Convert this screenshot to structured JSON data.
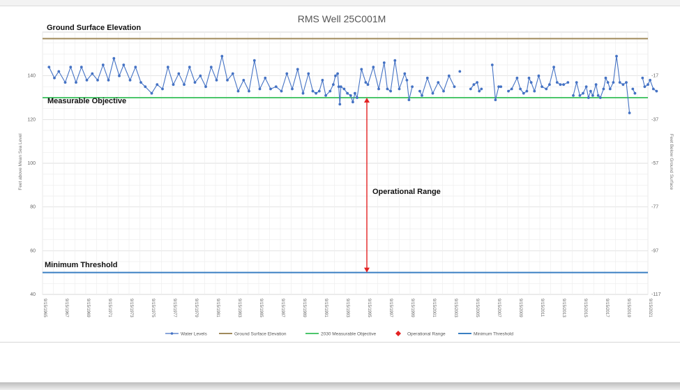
{
  "chart_data": {
    "type": "line",
    "title": "RMS Well 25C001M",
    "ylabel": "Feet above Mean Sea Level",
    "y2label": "Feet Below Ground Surface",
    "ylim": [
      40,
      160
    ],
    "y_ticks": [
      40,
      60,
      80,
      100,
      120,
      140
    ],
    "y2_ticks": [
      -117,
      -97,
      -77,
      -57,
      -37,
      -17
    ],
    "grid": true,
    "x_tick_labels": [
      "9/15/1965",
      "9/15/1967",
      "9/15/1969",
      "9/15/1971",
      "9/15/1973",
      "9/15/1975",
      "9/15/1977",
      "9/15/1979",
      "9/15/1981",
      "9/15/1983",
      "9/15/1985",
      "9/15/1987",
      "9/15/1989",
      "9/15/1991",
      "9/15/1993",
      "9/15/1995",
      "9/15/1997",
      "9/15/1999",
      "9/15/2001",
      "9/15/2003",
      "9/15/2005",
      "9/15/2007",
      "9/15/2009",
      "9/15/2011",
      "9/15/2013",
      "9/15/2015",
      "9/15/2017",
      "9/15/2019",
      "9/15/2021"
    ],
    "legend_position": "bottom",
    "legend": [
      {
        "key": "water",
        "label": "Water Levels",
        "color": "#4472c4",
        "style": "line-marker"
      },
      {
        "key": "gse",
        "label": "Ground Surface Elevation",
        "color": "#a08a5c",
        "style": "line"
      },
      {
        "key": "mo",
        "label": "2030 Measurable Objective",
        "color": "#4cc66b",
        "style": "line"
      },
      {
        "key": "op",
        "label": "Operational Range",
        "color": "#e32222",
        "style": "diamond"
      },
      {
        "key": "mt",
        "label": "Minimum Threshold",
        "color": "#3a7fc2",
        "style": "line"
      }
    ],
    "reference_lines": [
      {
        "key": "gse",
        "name": "Ground Surface Elevation",
        "value": 157,
        "color": "#a08a5c"
      },
      {
        "key": "mo",
        "name": "Measurable Objective",
        "value": 130,
        "color": "#4cc66b"
      },
      {
        "key": "mt",
        "name": "Minimum Threshold",
        "value": 50,
        "color": "#3a7fc2"
      }
    ],
    "operational_range": {
      "label": "Operational Range",
      "x": 1995.7,
      "from": 130,
      "to": 50,
      "color": "#e32222"
    },
    "series": [
      {
        "name": "Water Levels",
        "color": "#4472c4",
        "segments": [
          [
            [
              1966.3,
              144
            ],
            [
              1966.8,
              139
            ],
            [
              1967.2,
              142
            ],
            [
              1967.8,
              137
            ],
            [
              1968.3,
              144
            ],
            [
              1968.8,
              137
            ],
            [
              1969.3,
              144
            ],
            [
              1969.8,
              138
            ],
            [
              1970.3,
              141
            ],
            [
              1970.8,
              138
            ],
            [
              1971.3,
              145
            ],
            [
              1971.8,
              138
            ],
            [
              1972.3,
              148
            ],
            [
              1972.8,
              140
            ],
            [
              1973.2,
              145
            ],
            [
              1973.8,
              138
            ],
            [
              1974.3,
              144
            ],
            [
              1974.8,
              137
            ],
            [
              1975.2,
              135
            ],
            [
              1975.8,
              132
            ],
            [
              1976.3,
              136
            ],
            [
              1976.8,
              134
            ],
            [
              1977.3,
              144
            ],
            [
              1977.8,
              136
            ],
            [
              1978.3,
              141
            ],
            [
              1978.8,
              136
            ],
            [
              1979.3,
              144
            ],
            [
              1979.8,
              137
            ],
            [
              1980.3,
              140
            ],
            [
              1980.8,
              135
            ],
            [
              1981.3,
              144
            ],
            [
              1981.8,
              138
            ],
            [
              1982.3,
              149
            ],
            [
              1982.8,
              138
            ],
            [
              1983.3,
              141
            ],
            [
              1983.8,
              133
            ],
            [
              1984.3,
              138
            ],
            [
              1984.8,
              133
            ],
            [
              1985.3,
              147
            ],
            [
              1985.8,
              134
            ],
            [
              1986.3,
              139
            ],
            [
              1986.8,
              134
            ],
            [
              1987.3,
              135
            ],
            [
              1987.8,
              133
            ],
            [
              1988.3,
              141
            ],
            [
              1988.8,
              134
            ],
            [
              1989.3,
              143
            ],
            [
              1989.8,
              132
            ],
            [
              1990.3,
              141
            ],
            [
              1990.7,
              133
            ],
            [
              1991.0,
              132
            ],
            [
              1991.3,
              133
            ],
            [
              1991.6,
              138
            ],
            [
              1991.9,
              131
            ],
            [
              1992.3,
              133
            ],
            [
              1992.6,
              136
            ],
            [
              1992.8,
              140
            ],
            [
              1993.0,
              141
            ],
            [
              1993.1,
              135
            ],
            [
              1993.2,
              127
            ],
            [
              1993.3,
              135
            ],
            [
              1993.6,
              134
            ],
            [
              1993.9,
              132
            ],
            [
              1994.2,
              131
            ],
            [
              1994.4,
              128
            ],
            [
              1994.6,
              132
            ],
            [
              1994.8,
              130
            ],
            [
              1995.2,
              143
            ],
            [
              1995.6,
              137
            ],
            [
              1995.8,
              136
            ],
            [
              1996.3,
              144
            ],
            [
              1996.8,
              134
            ],
            [
              1997.3,
              146
            ],
            [
              1997.6,
              134
            ],
            [
              1997.9,
              133
            ],
            [
              1998.3,
              147
            ],
            [
              1998.7,
              134
            ],
            [
              1999.2,
              141
            ],
            [
              1999.4,
              138
            ],
            [
              1999.6,
              129
            ],
            [
              1999.9,
              135
            ]
          ],
          [
            [
              2000.6,
              133
            ],
            [
              2000.8,
              131
            ],
            [
              2001.3,
              139
            ],
            [
              2001.8,
              132
            ],
            [
              2002.3,
              137
            ],
            [
              2002.8,
              133
            ],
            [
              2003.3,
              140
            ],
            [
              2003.8,
              135
            ]
          ],
          [
            [
              2004.3,
              142
            ]
          ],
          [
            [
              2005.3,
              134
            ],
            [
              2005.6,
              136
            ],
            [
              2005.9,
              137
            ],
            [
              2006.1,
              133
            ],
            [
              2006.3,
              134
            ]
          ],
          [
            [
              2007.3,
              145
            ],
            [
              2007.6,
              129
            ],
            [
              2007.9,
              135
            ],
            [
              2008.1,
              135
            ]
          ],
          [
            [
              2008.8,
              133
            ],
            [
              2009.1,
              134
            ],
            [
              2009.6,
              139
            ],
            [
              2009.9,
              134
            ],
            [
              2010.2,
              132
            ],
            [
              2010.5,
              133
            ],
            [
              2010.7,
              139
            ],
            [
              2010.9,
              137
            ],
            [
              2011.2,
              133
            ],
            [
              2011.6,
              140
            ],
            [
              2011.9,
              135
            ],
            [
              2012.3,
              134
            ],
            [
              2012.6,
              136
            ],
            [
              2013.0,
              144
            ],
            [
              2013.3,
              137
            ],
            [
              2013.6,
              136
            ],
            [
              2013.9,
              136
            ],
            [
              2014.3,
              137
            ]
          ],
          [
            [
              2014.8,
              131
            ],
            [
              2015.1,
              137
            ],
            [
              2015.4,
              131
            ],
            [
              2015.7,
              132
            ],
            [
              2016.0,
              135
            ],
            [
              2016.2,
              130
            ],
            [
              2016.4,
              133
            ],
            [
              2016.6,
              131
            ],
            [
              2016.9,
              136
            ],
            [
              2017.1,
              131
            ],
            [
              2017.3,
              130
            ],
            [
              2017.6,
              134
            ],
            [
              2017.8,
              139
            ],
            [
              2018.0,
              137
            ],
            [
              2018.2,
              134
            ],
            [
              2018.5,
              137
            ],
            [
              2018.8,
              149
            ],
            [
              2019.1,
              137
            ],
            [
              2019.4,
              136
            ],
            [
              2019.7,
              137
            ],
            [
              2020.0,
              123
            ]
          ],
          [
            [
              2020.3,
              134
            ],
            [
              2020.5,
              132
            ]
          ],
          [
            [
              2021.2,
              139
            ],
            [
              2021.4,
              135
            ],
            [
              2021.7,
              136
            ],
            [
              2021.9,
              138
            ],
            [
              2022.2,
              134
            ],
            [
              2022.5,
              133
            ]
          ]
        ]
      }
    ]
  }
}
